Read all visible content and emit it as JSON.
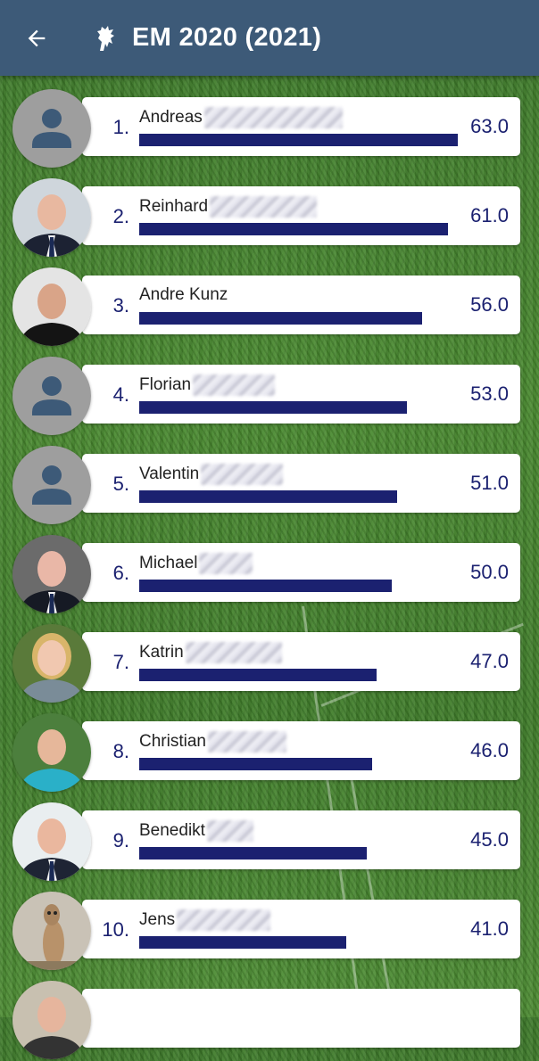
{
  "app": {
    "title": "EM 2020 (2021)",
    "back_icon": "arrow-left-icon",
    "crest_icon": "lion-crest-icon"
  },
  "colors": {
    "appbar": "#3d5a78",
    "bar": "#1b2170",
    "text_accent": "#1b2170"
  },
  "ranking": [
    {
      "rank": "1.",
      "name": "Andreas",
      "score": "63.0",
      "score_value": 63.0,
      "avatar": "placeholder"
    },
    {
      "rank": "2.",
      "name": "Reinhard",
      "score": "61.0",
      "score_value": 61.0,
      "avatar": "photo"
    },
    {
      "rank": "3.",
      "name": "Andre Kunz",
      "score": "56.0",
      "score_value": 56.0,
      "avatar": "photo"
    },
    {
      "rank": "4.",
      "name": "Florian",
      "score": "53.0",
      "score_value": 53.0,
      "avatar": "placeholder"
    },
    {
      "rank": "5.",
      "name": "Valentin",
      "score": "51.0",
      "score_value": 51.0,
      "avatar": "placeholder"
    },
    {
      "rank": "6.",
      "name": "Michael",
      "score": "50.0",
      "score_value": 50.0,
      "avatar": "photo"
    },
    {
      "rank": "7.",
      "name": "Katrin",
      "score": "47.0",
      "score_value": 47.0,
      "avatar": "photo"
    },
    {
      "rank": "8.",
      "name": "Christian",
      "score": "46.0",
      "score_value": 46.0,
      "avatar": "photo"
    },
    {
      "rank": "9.",
      "name": "Benedikt",
      "score": "45.0",
      "score_value": 45.0,
      "avatar": "photo"
    },
    {
      "rank": "10.",
      "name": "Jens",
      "score": "41.0",
      "score_value": 41.0,
      "avatar": "photo"
    },
    {
      "rank": "",
      "name": "",
      "score": "",
      "score_value": null,
      "avatar": "photo"
    }
  ]
}
